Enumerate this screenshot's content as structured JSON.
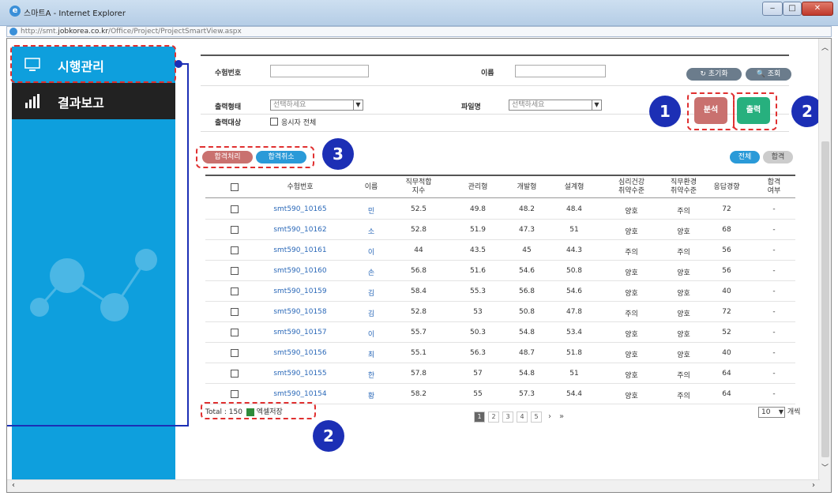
{
  "window": {
    "title": "스마트A - Internet Explorer",
    "min": "‒",
    "max": "□",
    "close": "✕",
    "ie_icon": "e"
  },
  "address": {
    "prefix": "http://smt.",
    "domain": "jobkorea.co.kr",
    "path": "/Office/Project/ProjectSmartView.aspx"
  },
  "sidebar": {
    "items": [
      {
        "label": "시행관리",
        "icon": "monitor-icon"
      },
      {
        "label": "결과보고",
        "icon": "bar-chart-icon"
      }
    ]
  },
  "search": {
    "exam_no_label": "수험번호",
    "name_label": "이름",
    "reset_label": "↻ 초기화",
    "search_label": "🔍 조회",
    "output_type_label": "출력형태",
    "output_type_value": "선택하세요",
    "filename_label": "파일명",
    "filename_value": "선택하세요",
    "output_target_label": "출력대상",
    "all_candidates_label": "응시자 전체"
  },
  "actions": {
    "analyze": "분석",
    "print": "출력",
    "pass_process": "합격처리",
    "pass_cancel": "합격취소",
    "all": "전체",
    "pass": "합격"
  },
  "badges": {
    "one": "1",
    "two": "2",
    "three": "3",
    "two_b": "2"
  },
  "table": {
    "headers": [
      "수험번호",
      "이름",
      "직무적합\n지수",
      "관리형",
      "개발형",
      "설계형",
      "심리건강\n취약수준",
      "직무환경\n취약수준",
      "응답경향",
      "합격\n여부"
    ],
    "rows": [
      [
        "smt590_10165",
        "민",
        "52.5",
        "49.8",
        "48.2",
        "48.4",
        "양호",
        "주의",
        "72",
        "-"
      ],
      [
        "smt590_10162",
        "소",
        "52.8",
        "51.9",
        "47.3",
        "51",
        "양호",
        "양호",
        "68",
        "-"
      ],
      [
        "smt590_10161",
        "이",
        "44",
        "43.5",
        "45",
        "44.3",
        "주의",
        "주의",
        "56",
        "-"
      ],
      [
        "smt590_10160",
        "손",
        "56.8",
        "51.6",
        "54.6",
        "50.8",
        "양호",
        "양호",
        "56",
        "-"
      ],
      [
        "smt590_10159",
        "김",
        "58.4",
        "55.3",
        "56.8",
        "54.6",
        "양호",
        "양호",
        "40",
        "-"
      ],
      [
        "smt590_10158",
        "김",
        "52.8",
        "53",
        "50.8",
        "47.8",
        "주의",
        "양호",
        "72",
        "-"
      ],
      [
        "smt590_10157",
        "이",
        "55.7",
        "50.3",
        "54.8",
        "53.4",
        "양호",
        "양호",
        "52",
        "-"
      ],
      [
        "smt590_10156",
        "최",
        "55.1",
        "56.3",
        "48.7",
        "51.8",
        "양호",
        "양호",
        "40",
        "-"
      ],
      [
        "smt590_10155",
        "한",
        "57.8",
        "57",
        "54.8",
        "51",
        "양호",
        "주의",
        "64",
        "-"
      ],
      [
        "smt590_10154",
        "황",
        "58.2",
        "55",
        "57.3",
        "54.4",
        "양호",
        "주의",
        "64",
        "-"
      ]
    ]
  },
  "footer": {
    "total": "Total : 150",
    "excel": "엑셀저장",
    "pages": [
      "1",
      "2",
      "3",
      "4",
      "5"
    ],
    "next": "›",
    "last": "»",
    "per_page": "10",
    "per_page_suffix": "개씩"
  },
  "colors": {
    "sidebar": "#0e9fdd",
    "analyze": "#c9716f",
    "print": "#27b07e",
    "badge": "#1c2fb5",
    "dash": "#e03030"
  }
}
